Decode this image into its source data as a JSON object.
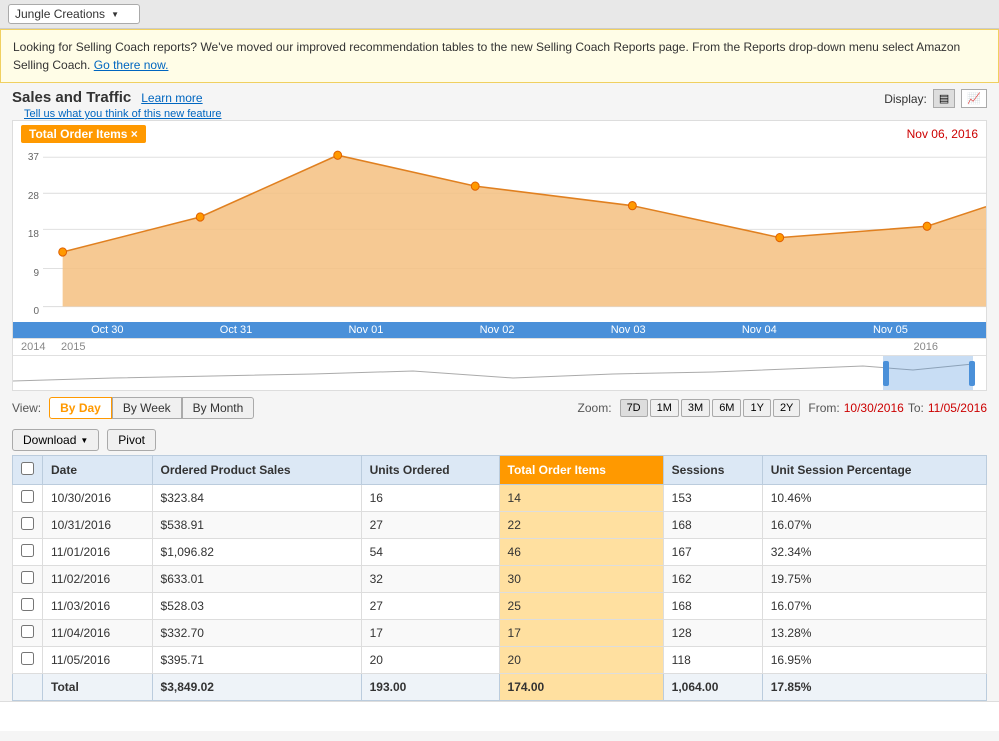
{
  "topbar": {
    "store_name": "Jungle Creations"
  },
  "banner": {
    "text": "Looking for Selling Coach reports? We've moved our improved recommendation tables to the new Selling Coach Reports page. From the Reports drop-down menu select Amazon Selling Coach.",
    "link_text": "Go there now."
  },
  "section": {
    "title": "Sales and Traffic",
    "learn_more": "Learn more",
    "feedback_text": "Tell us what you think of this new feature",
    "display_label": "Display:"
  },
  "chart": {
    "tag": "Total Order Items ×",
    "date": "Nov 06, 2016",
    "y_labels": [
      "37",
      "28",
      "18",
      "9",
      "0"
    ],
    "x_labels": [
      "Oct 30",
      "Oct 31",
      "Nov 01",
      "Nov 02",
      "Nov 03",
      "Nov 04",
      "Nov 05"
    ]
  },
  "timeline": {
    "years": [
      "2014",
      "2015",
      "",
      "",
      "",
      "",
      "2016",
      "",
      "",
      ""
    ]
  },
  "view": {
    "label": "View:",
    "options": [
      "By Day",
      "By Week",
      "By Month"
    ],
    "active": "By Day"
  },
  "zoom": {
    "label": "Zoom:",
    "options": [
      "7D",
      "1M",
      "3M",
      "6M",
      "1Y",
      "2Y"
    ],
    "active": "7D"
  },
  "date_range": {
    "from_label": "From:",
    "from_value": "10/30/2016",
    "to_label": "To:",
    "to_value": "11/05/2016"
  },
  "actions": {
    "download_label": "Download",
    "pivot_label": "Pivot"
  },
  "table": {
    "columns": [
      "",
      "Date",
      "Ordered Product Sales",
      "Units Ordered",
      "Total Order Items",
      "Sessions",
      "Unit Session Percentage"
    ],
    "highlighted_col": 4,
    "rows": [
      [
        "",
        "10/30/2016",
        "$323.84",
        "16",
        "14",
        "153",
        "10.46%"
      ],
      [
        "",
        "10/31/2016",
        "$538.91",
        "27",
        "22",
        "168",
        "16.07%"
      ],
      [
        "",
        "11/01/2016",
        "$1,096.82",
        "54",
        "46",
        "167",
        "32.34%"
      ],
      [
        "",
        "11/02/2016",
        "$633.01",
        "32",
        "30",
        "162",
        "19.75%"
      ],
      [
        "",
        "11/03/2016",
        "$528.03",
        "27",
        "25",
        "168",
        "16.07%"
      ],
      [
        "",
        "11/04/2016",
        "$332.70",
        "17",
        "17",
        "128",
        "13.28%"
      ],
      [
        "",
        "11/05/2016",
        "$395.71",
        "20",
        "20",
        "118",
        "16.95%"
      ]
    ],
    "footer": [
      "",
      "Total",
      "$3,849.02",
      "193.00",
      "174.00",
      "1,064.00",
      "17.85%"
    ]
  }
}
